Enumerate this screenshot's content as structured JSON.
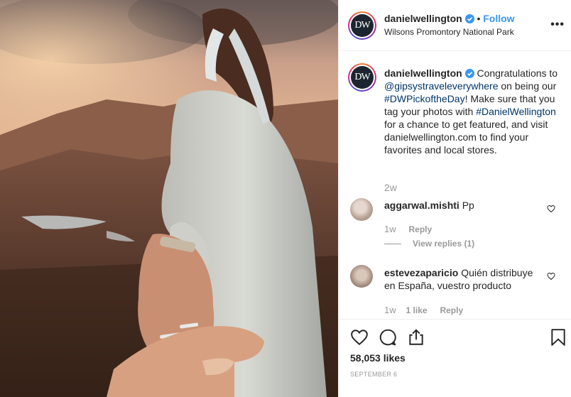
{
  "post": {
    "username": "danielwellington",
    "avatar_initials": "DW",
    "follow_label": "Follow",
    "location": "Wilsons Promontory National Park",
    "more_label": "•••"
  },
  "caption": {
    "username": "danielwellington",
    "text_1": "Congratulations to ",
    "mention": "@gipsystraveleverywhere",
    "text_2": " on being our ",
    "hashtag_1": "#DWPickoftheDay",
    "text_3": "! Make sure that you tag your photos with ",
    "hashtag_2": "#DanielWellington",
    "text_4": " for a chance to get featured, and visit danielwellington.com to find your favorites and local stores.",
    "age": "2w"
  },
  "comments": [
    {
      "username": "aggarwal.mishti",
      "text": "Pp",
      "age": "1w",
      "reply_label": "Reply",
      "view_replies_label": "View replies (1)"
    },
    {
      "username": "estevezaparicio",
      "text": "Quién distribuye en España, vuestro producto",
      "age": "1w",
      "likes_label": "1 like",
      "reply_label": "Reply"
    }
  ],
  "stats": {
    "likes": "58,053 likes",
    "date": "SEPTEMBER 6"
  },
  "colors": {
    "accent": "#3897f0",
    "link": "#003569",
    "muted": "#999999",
    "border": "#efefef"
  },
  "icons": [
    "verified-badge-icon",
    "more-options-icon",
    "heart-icon",
    "comment-icon",
    "share-icon",
    "bookmark-icon"
  ]
}
